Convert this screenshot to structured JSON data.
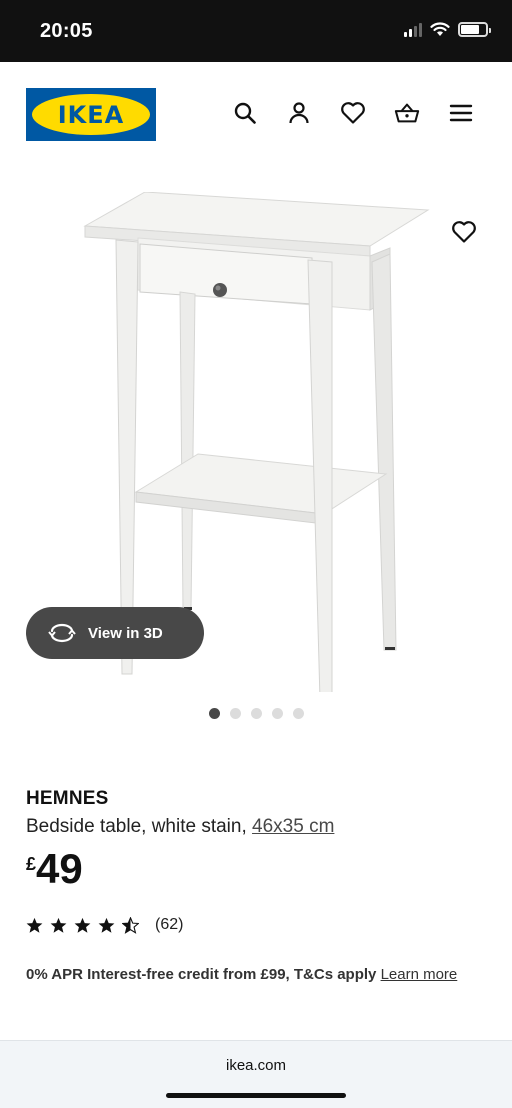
{
  "status_bar": {
    "time": "20:05"
  },
  "header": {
    "logo_text": "IKEA",
    "icons": [
      "search-icon",
      "account-icon",
      "heart-icon",
      "basket-icon",
      "menu-icon"
    ]
  },
  "gallery": {
    "view3d_label": "View in 3D",
    "slide_count": 5,
    "active_slide": 1
  },
  "product": {
    "name": "HEMNES",
    "description": "Bedside table, white stain, ",
    "measurement": "46x35 cm",
    "price_currency": "£",
    "price_value": "49",
    "rating_stars": 4.5,
    "rating_count": "(62)"
  },
  "credit": {
    "text": "0% APR Interest-free credit from £99, T&Cs apply ",
    "link": "Learn more"
  },
  "browser": {
    "url": "ikea.com"
  },
  "colors": {
    "ikea_blue": "#0058a3",
    "ikea_yellow": "#ffdb00",
    "button_dark": "#484848",
    "status_bar": "#111111"
  }
}
